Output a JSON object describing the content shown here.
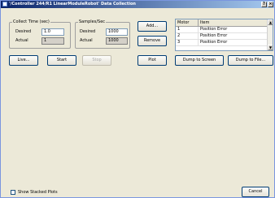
{
  "window": {
    "title": "'/Controller 244/R1 LinearModuleRobot' Data Collection",
    "help_button": "?",
    "close_button": "×"
  },
  "collect_time": {
    "group_label": "Collect Time (sec)",
    "desired_label": "Desired",
    "desired_value": "1.0",
    "actual_label": "Actual",
    "actual_value": "1"
  },
  "samples": {
    "group_label": "Samples/Sec",
    "desired_label": "Desired",
    "desired_value": "1000",
    "actual_label": "Actual",
    "actual_value": "1000"
  },
  "buttons": {
    "add": "Add...",
    "remove": "Remove",
    "live": "Live...",
    "start": "Start",
    "stop": "Stop",
    "plot": "Plot",
    "dump_screen": "Dump to Screen",
    "dump_file": "Dump to File...",
    "cancel": "Cancel"
  },
  "table": {
    "headers": [
      "Motor",
      "Item"
    ],
    "rows": [
      [
        "1",
        "Position Error"
      ],
      [
        "2",
        "Position Error"
      ],
      [
        "3",
        "Position Error"
      ]
    ],
    "scroll_up": "▲",
    "scroll_down": "▼"
  },
  "footer": {
    "stacked_plots_label": "Show Stacked Plots",
    "stacked_plots_checked": false
  },
  "colors": {
    "title_start": "#0a246a",
    "title_end": "#a6caf0",
    "window_bg": "#ece9d8"
  }
}
